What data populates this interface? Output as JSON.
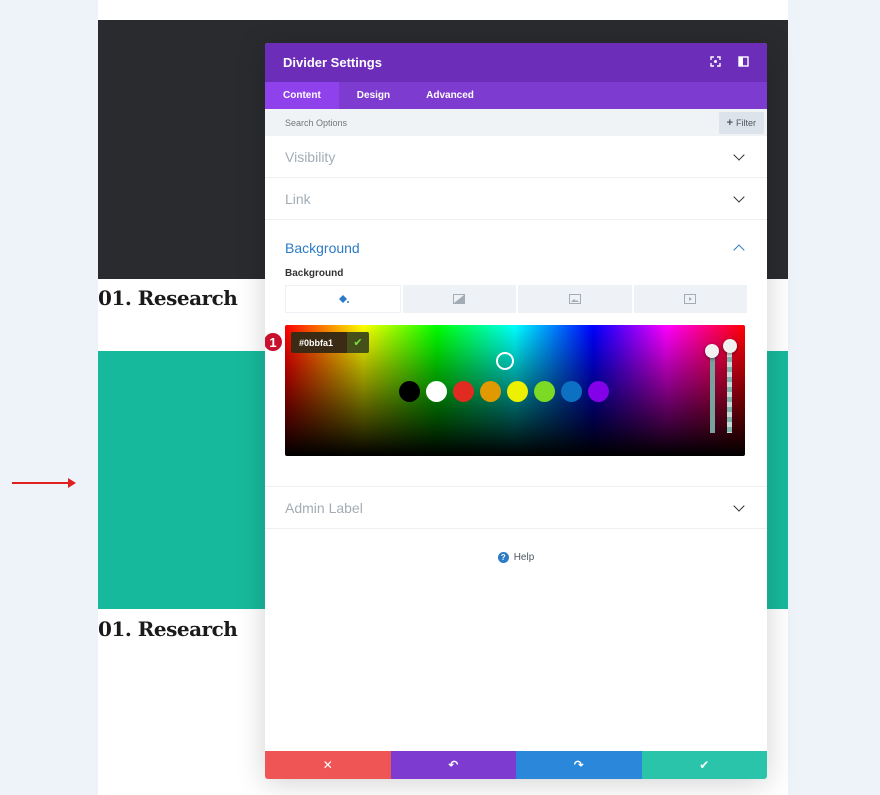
{
  "page": {
    "heading_1": "01. Research",
    "heading_2": "01. Research",
    "colors": {
      "dark": "#2a2b2f",
      "teal": "#17b99c"
    }
  },
  "modal": {
    "title": "Divider Settings",
    "header_icons": [
      "fullscreen-icon",
      "sidebar-toggle-icon"
    ],
    "tabs": [
      {
        "label": "Content",
        "active": true
      },
      {
        "label": "Design",
        "active": false
      },
      {
        "label": "Advanced",
        "active": false
      }
    ],
    "search": {
      "placeholder": "Search Options",
      "filter_label": "Filter"
    },
    "sections": {
      "visibility": "Visibility",
      "link": "Link",
      "background": "Background",
      "admin_label": "Admin Label"
    },
    "background": {
      "field_label": "Background",
      "type_tabs": [
        "color-fill-icon",
        "gradient-icon",
        "image-icon",
        "video-icon"
      ],
      "hex_value": "#0bbfa1",
      "annotation_badge": "1",
      "swatches": [
        "#000000",
        "#ffffff",
        "#e02b20",
        "#e09900",
        "#edf000",
        "#7cda24",
        "#0c71c3",
        "#8300e9"
      ]
    },
    "help_label": "Help",
    "footer": {
      "cancel_color": "#ef5555",
      "undo_color": "#7e3bd0",
      "redo_color": "#2b87da",
      "save_color": "#29c4a9"
    }
  }
}
